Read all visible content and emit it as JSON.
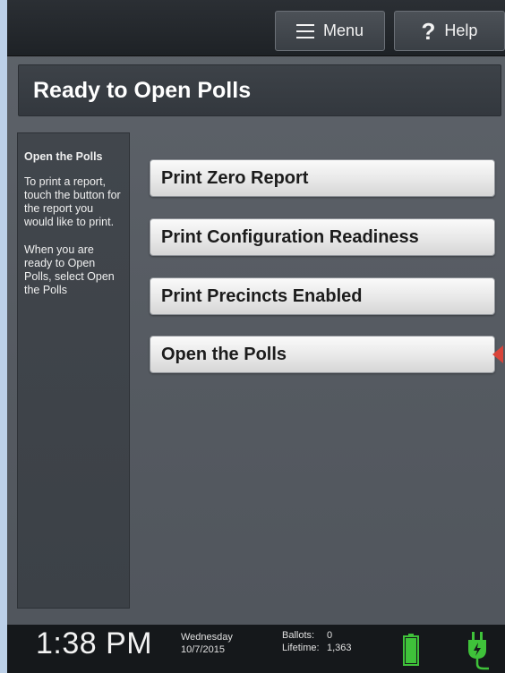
{
  "topbar": {
    "menu_label": "Menu",
    "help_label": "Help"
  },
  "title": "Ready to Open Polls",
  "sidepanel": {
    "heading": "Open the Polls",
    "para1": "To print a report, touch the button for the report you would like to print.",
    "para2": "When you are ready to Open Polls, select Open the Polls"
  },
  "actions": [
    {
      "label": "Print Zero Report"
    },
    {
      "label": "Print Configuration Readiness"
    },
    {
      "label": "Print Precincts Enabled"
    },
    {
      "label": "Open the Polls"
    }
  ],
  "status": {
    "time": "1:38 PM",
    "day": "Wednesday",
    "date": "10/7/2015",
    "ballots_label": "Ballots:",
    "ballots_value": "0",
    "lifetime_label": "Lifetime:",
    "lifetime_value": "1,363"
  },
  "colors": {
    "accent_pointer": "#d9443a",
    "battery": "#3fc23a",
    "power": "#3fc23a"
  }
}
